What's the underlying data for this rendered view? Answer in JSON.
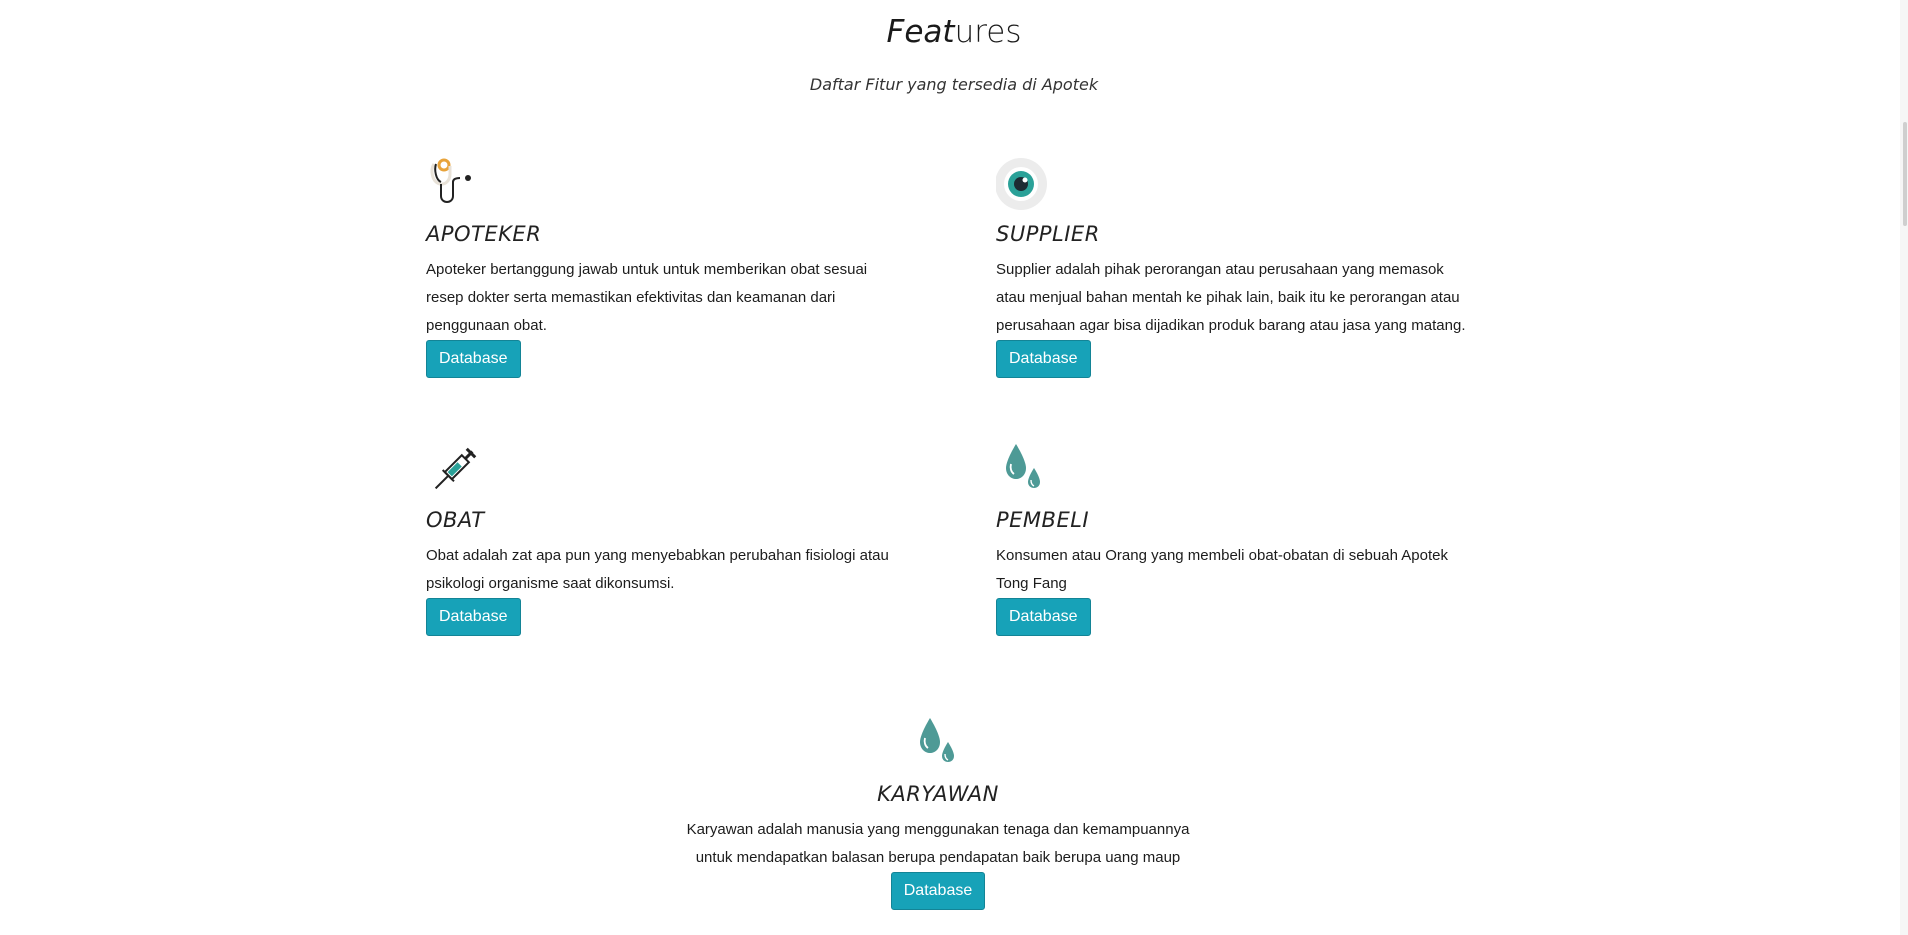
{
  "section": {
    "title_part1": "Feat",
    "title_part2": "ures",
    "subtitle": "Daftar Fitur yang tersedia di Apotek"
  },
  "features": [
    {
      "title": "APOTEKER",
      "icon": "stethoscope-icon",
      "description": "Apoteker bertanggung jawab untuk untuk memberikan obat sesuai resep dokter serta memastikan efektivitas dan keamanan dari penggunaan obat.",
      "button": "Database"
    },
    {
      "title": "SUPPLIER",
      "icon": "eye-icon",
      "description": "Supplier adalah pihak perorangan atau perusahaan yang memasok atau menjual bahan mentah ke pihak lain, baik itu ke perorangan atau perusahaan agar bisa dijadikan produk barang atau jasa yang matang.",
      "button": "Database"
    },
    {
      "title": "OBAT",
      "icon": "syringe-icon",
      "description": "Obat adalah zat apa pun yang menyebabkan perubahan fisiologi atau psikologi organisme saat dikonsumsi.",
      "button": "Database"
    },
    {
      "title": "PEMBELI",
      "icon": "droplets-icon",
      "description": "Konsumen atau Orang yang membeli obat-obatan di sebuah Apotek Tong Fang",
      "button": "Database"
    },
    {
      "title": "KARYAWAN",
      "icon": "droplets-icon",
      "description": "Karyawan adalah manusia yang menggunakan tenaga dan kemampuannya untuk mendapatkan balasan berupa pendapatan baik berupa uang maup",
      "button": "Database"
    }
  ],
  "colors": {
    "button": "#17a2b8",
    "icon_teal": "#4e9a96"
  }
}
